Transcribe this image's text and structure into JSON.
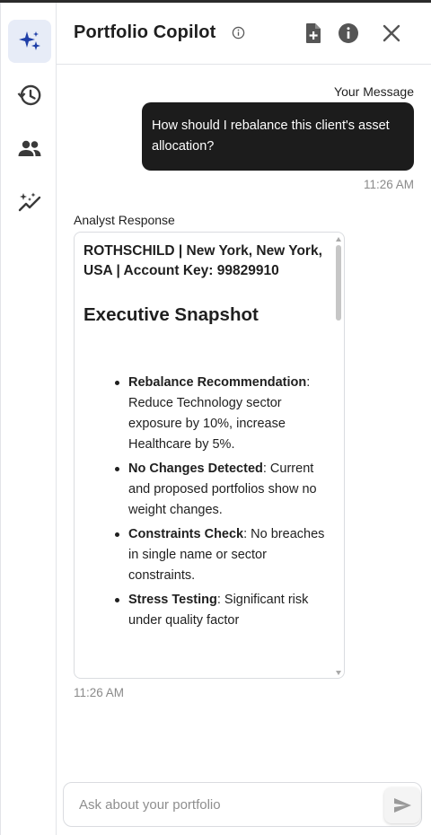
{
  "header": {
    "title": "Portfolio Copilot"
  },
  "sidebar": {
    "items": [
      {
        "icon": "sparkle-icon",
        "active": true
      },
      {
        "icon": "history-icon",
        "active": false
      },
      {
        "icon": "people-icon",
        "active": false
      },
      {
        "icon": "insights-icon",
        "active": false
      }
    ]
  },
  "conversation": {
    "user": {
      "caption": "Your Message",
      "text": "How should I rebalance this client's asset allocation?",
      "time": "11:26 AM"
    },
    "analyst": {
      "caption": "Analyst Response",
      "account_line": "ROTHSCHILD | New York, New York, USA | Account Key: 99829910",
      "heading": "Executive Snapshot",
      "bullets": [
        {
          "label": "Rebalance Recommendation",
          "text": ": Reduce Technology sector exposure by 10%, increase Healthcare by 5%."
        },
        {
          "label": "No Changes Detected",
          "text": ": Current and proposed portfolios show no weight changes."
        },
        {
          "label": "Constraints Check",
          "text": ": No breaches in single name or sector constraints."
        },
        {
          "label": "Stress Testing",
          "text": ": Significant risk under quality factor"
        }
      ],
      "time": "11:26 AM"
    }
  },
  "composer": {
    "placeholder": "Ask about your portfolio"
  },
  "colors": {
    "accent": "#1f3fa8",
    "active_bg": "#e7ecf7",
    "bubble_bg": "#1c1c1c",
    "icon": "#3a3a3a"
  }
}
